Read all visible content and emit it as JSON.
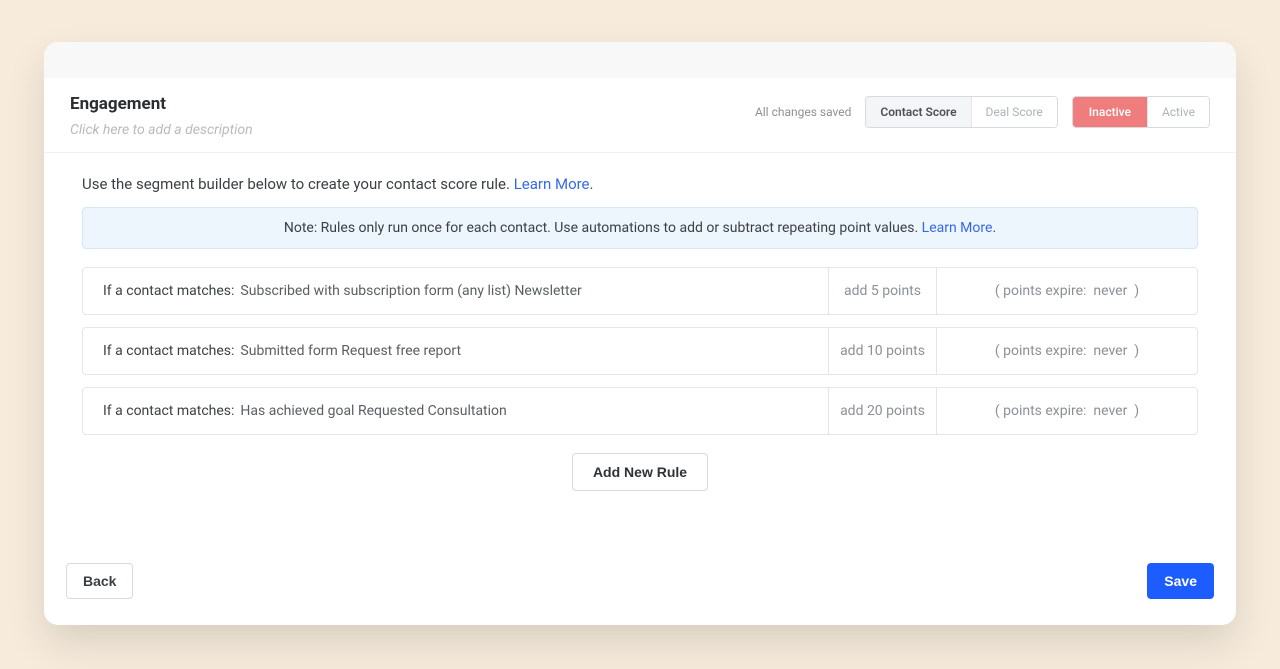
{
  "header": {
    "title": "Engagement",
    "description_placeholder": "Click here to add a description",
    "saved_status": "All changes saved",
    "score_tabs": {
      "contact": "Contact Score",
      "deal": "Deal Score"
    },
    "state_tabs": {
      "inactive": "Inactive",
      "active": "Active"
    }
  },
  "intro": {
    "text": "Use the segment builder below to create your contact score rule. ",
    "learn_more": "Learn More"
  },
  "note": {
    "text": "Note: Rules only run once for each contact. Use automations to add or subtract repeating point values. ",
    "learn_more": "Learn More"
  },
  "match_label": "If a contact matches:",
  "expire_prefix": "( points expire:",
  "expire_suffix": ")",
  "rules": [
    {
      "condition": "Subscribed with subscription form (any list) Newsletter",
      "points": "add 5 points",
      "expire": "never"
    },
    {
      "condition": "Submitted form Request free report",
      "points": "add 10 points",
      "expire": "never"
    },
    {
      "condition": "Has achieved goal Requested Consultation",
      "points": "add 20 points",
      "expire": "never"
    }
  ],
  "buttons": {
    "add_rule": "Add New Rule",
    "back": "Back",
    "save": "Save"
  }
}
